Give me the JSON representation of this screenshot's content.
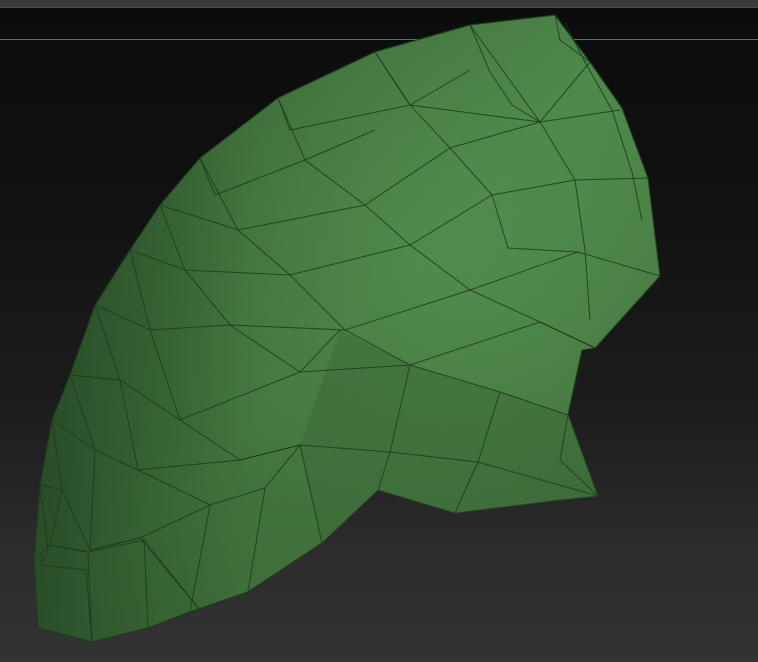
{
  "viewport": {
    "background": "#1a1a1a",
    "object": {
      "kind": "polygon-mesh",
      "base_color": "#4e8a4a",
      "wire_color": "#1f3a1d",
      "shading": "flat-lit"
    }
  }
}
